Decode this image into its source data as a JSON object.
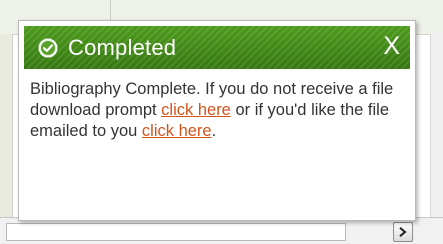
{
  "notification": {
    "title": "Completed",
    "close_label": "X",
    "check_icon": "check-circle-icon",
    "message": {
      "part1": "Bibliography Complete. If you do not receive a file download prompt ",
      "link1": "click here",
      "part2": " or if you'd like the file emailed to you ",
      "link2": "click here",
      "part3": "."
    }
  },
  "colors": {
    "header_green": "#3f8712",
    "link_orange": "#d2541d",
    "body_text": "#333333"
  }
}
